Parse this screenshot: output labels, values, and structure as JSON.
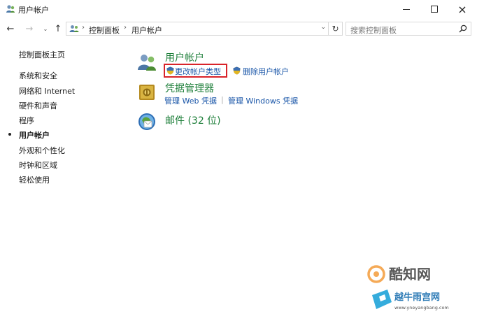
{
  "window": {
    "title": "用户帐户",
    "controls": {
      "minimize": "minimize-icon",
      "maximize": "maximize-icon",
      "close": "×"
    }
  },
  "nav": {
    "back": "←",
    "forward": "→",
    "recent": "⌄",
    "up": "↑",
    "breadcrumbs": [
      "控制面板",
      "用户帐户"
    ],
    "crumb_sep": "›",
    "dropdown": "⌄",
    "refresh": "↻"
  },
  "search": {
    "placeholder": "搜索控制面板"
  },
  "sidebar": {
    "home": "控制面板主页",
    "items": [
      {
        "label": "系统和安全",
        "active": false
      },
      {
        "label": "网络和 Internet",
        "active": false
      },
      {
        "label": "硬件和声音",
        "active": false
      },
      {
        "label": "程序",
        "active": false
      },
      {
        "label": "用户帐户",
        "active": true
      },
      {
        "label": "外观和个性化",
        "active": false
      },
      {
        "label": "时钟和区域",
        "active": false
      },
      {
        "label": "轻松使用",
        "active": false
      }
    ]
  },
  "main": {
    "categories": [
      {
        "title": "用户帐户",
        "icon": "user-accounts-icon",
        "links": [
          "更改帐户类型",
          "删除用户帐户"
        ]
      },
      {
        "title": "凭据管理器",
        "icon": "credential-manager-icon",
        "links": [
          "管理 Web 凭据",
          "管理 Windows 凭据"
        ],
        "separator": "|"
      },
      {
        "title": "邮件 (32 位)",
        "icon": "mail-icon",
        "links": []
      }
    ]
  },
  "watermark": {
    "brand": "酷知网",
    "secondary": "越牛雨宫网",
    "url": "www.yneyangbang.com"
  },
  "colors": {
    "category_title": "#1e7f3a",
    "link": "#1a56a8",
    "highlight_box": "#d9232a"
  }
}
